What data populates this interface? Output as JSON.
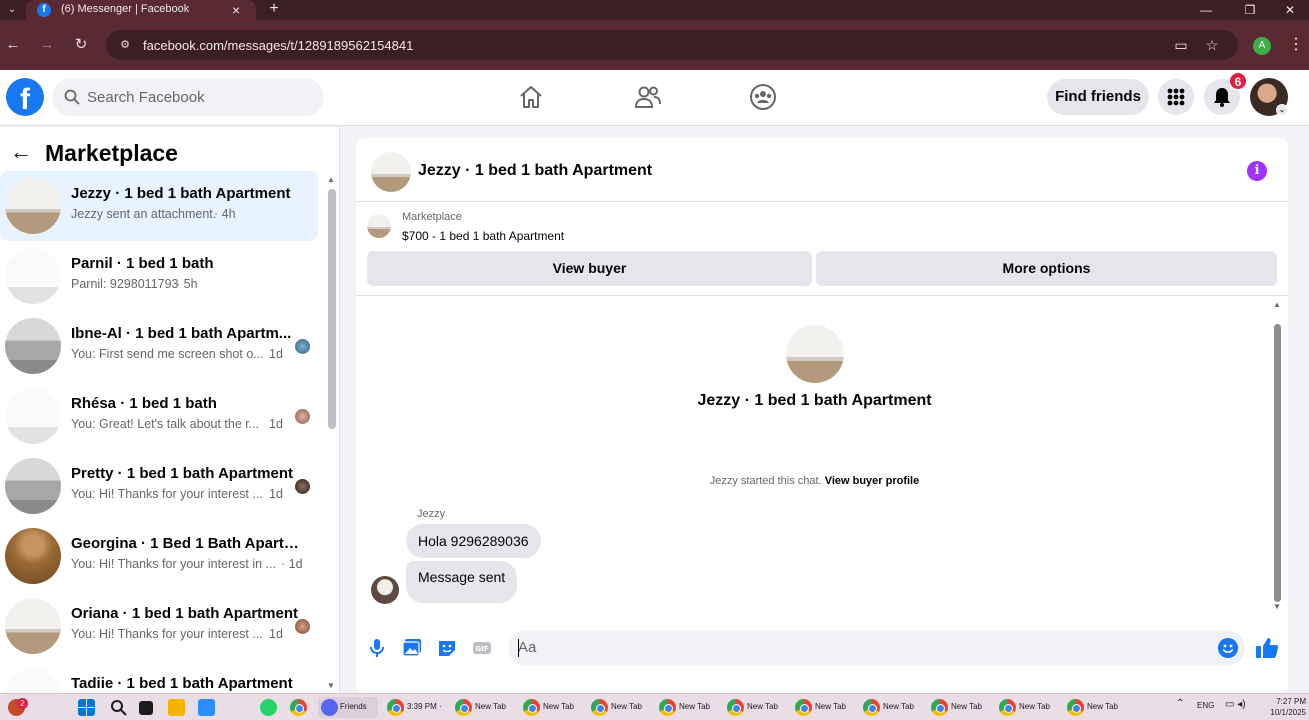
{
  "browser": {
    "tab_title": "(6) Messenger | Facebook",
    "url": "facebook.com/messages/t/1289189562154841",
    "profile_initial": "A"
  },
  "header": {
    "search_placeholder": "Search Facebook",
    "find_friends_label": "Find friends",
    "notification_count": "6"
  },
  "sidebar": {
    "title": "Marketplace",
    "conversations": [
      {
        "name": "Jezzy · 1 bed 1 bath Apartment",
        "preview": "Jezzy sent an attachment.",
        "time": "· 4h"
      },
      {
        "name": "Parnil · 1 bed 1 bath",
        "preview": "Parnil: 9298011793",
        "time": "· 5h"
      },
      {
        "name": "Ibne-Al · 1 bed 1 bath Apartm...",
        "preview": "You: First send me screen shot o...",
        "time": "1d"
      },
      {
        "name": "Rhésa · 1 bed 1 bath",
        "preview": "You: Great! Let's talk about the r...",
        "time": "1d"
      },
      {
        "name": "Pretty · 1 bed 1 bath Apartment",
        "preview": "You: Hi! Thanks for your interest ...",
        "time": "1d"
      },
      {
        "name": "Georgina · 1 Bed 1 Bath Apartme...",
        "preview": "You: Hi! Thanks for your interest in ...",
        "time": "· 1d"
      },
      {
        "name": "Oriana · 1 bed 1 bath Apartment",
        "preview": "You: Hi! Thanks for your interest ...",
        "time": "1d"
      },
      {
        "name": "Tadiie · 1 bed 1 bath Apartment",
        "preview": "",
        "time": ""
      }
    ]
  },
  "chat": {
    "title": "Jezzy · 1 bed 1 bath Apartment",
    "listing_category": "Marketplace",
    "listing_title": "$700 - 1 bed 1 bath Apartment",
    "view_buyer_label": "View buyer",
    "more_options_label": "More options",
    "profile_name": "Jezzy · 1 bed 1 bath Apartment",
    "system_message": "Jezzy started this chat.",
    "system_link": "View buyer profile",
    "sender": "Jezzy",
    "messages": [
      "Hola 9296289036",
      "Message sent"
    ],
    "composer_placeholder": "Aa"
  },
  "taskbar": {
    "notification_badge": "2",
    "friends_label": "Friends",
    "chrome_tab_time": "3:39 PM ·",
    "new_tab_labels": [
      "New Tab",
      "New Tab",
      "New Tab",
      "New Tab",
      "New Tab",
      "New Tab",
      "New Tab",
      "New Tab",
      "New Tab",
      "New Tab"
    ],
    "language": "ENG",
    "time": "7:27 PM",
    "date": "10/1/2025"
  },
  "colors": {
    "facebook_blue": "#1877f2",
    "info_purple": "#a033ff",
    "badge_red": "#e41e3f",
    "active_conv_bg": "#e7f3ff",
    "browser_frame": "#5a2a33"
  },
  "icons": [
    "search-icon",
    "home-icon",
    "friends-icon",
    "groups-icon",
    "apps-grid-icon",
    "bell-icon",
    "info-icon",
    "microphone-icon",
    "photo-icon",
    "sticker-icon",
    "gif-icon",
    "emoji-icon",
    "like-icon"
  ]
}
